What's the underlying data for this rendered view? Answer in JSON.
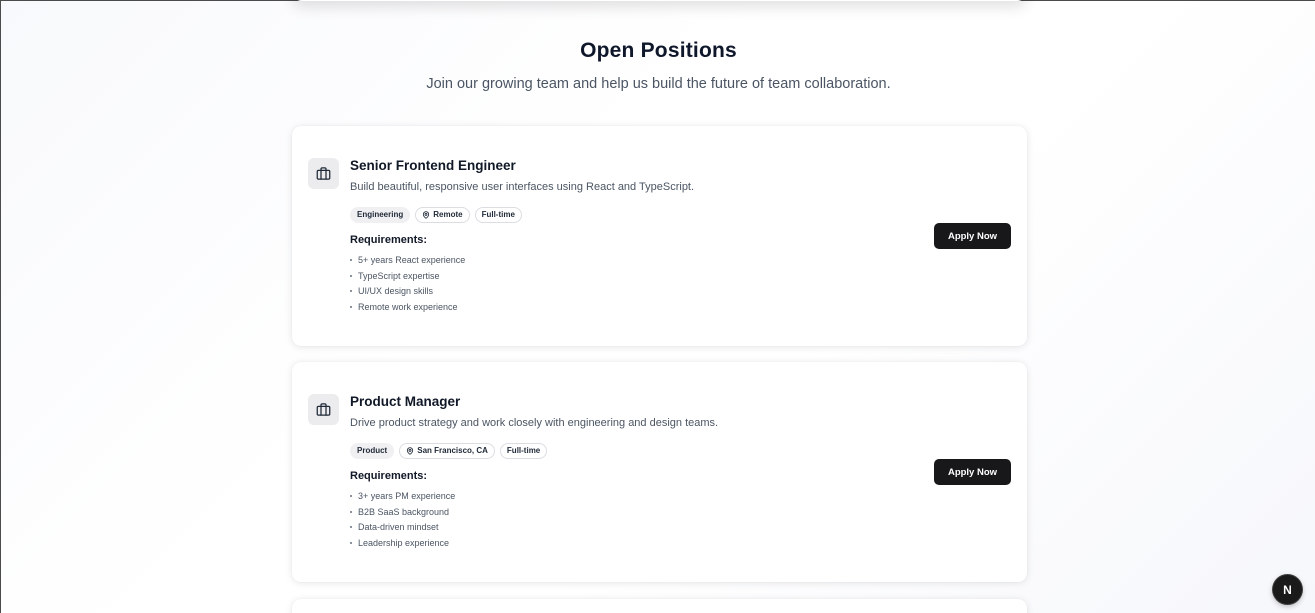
{
  "section": {
    "title": "Open Positions",
    "subtitle": "Join our growing team and help us build the future of team collaboration."
  },
  "icons": {
    "job": "briefcase-icon",
    "location": "map-pin-icon",
    "bullet": "bullet-dot",
    "devtools": "nextjs-logo-icon"
  },
  "jobs": [
    {
      "title": "Senior Frontend Engineer",
      "description": "Build beautiful, responsive user interfaces using React and TypeScript.",
      "department": "Engineering",
      "location": "Remote",
      "type": "Full-time",
      "requirements_label": "Requirements:",
      "requirements": [
        "5+ years React experience",
        "TypeScript expertise",
        "UI/UX design skills",
        "Remote work experience"
      ],
      "apply_label": "Apply Now"
    },
    {
      "title": "Product Manager",
      "description": "Drive product strategy and work closely with engineering and design teams.",
      "department": "Product",
      "location": "San Francisco, CA",
      "type": "Full-time",
      "requirements_label": "Requirements:",
      "requirements": [
        "3+ years PM experience",
        "B2B SaaS background",
        "Data-driven mindset",
        "Leadership experience"
      ],
      "apply_label": "Apply Now"
    }
  ],
  "devtools_badge": {
    "label": "N"
  },
  "colors": {
    "primary_button": "#18181b",
    "title_text": "#111827",
    "muted_text": "#4b5563",
    "tag_fill": "#f0f0f2",
    "icon_box": "#ececee"
  }
}
